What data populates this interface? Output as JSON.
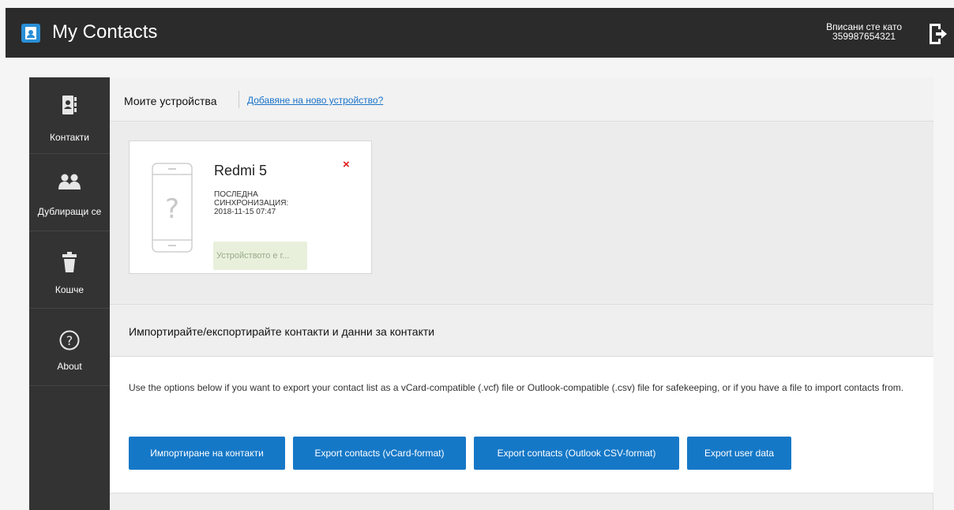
{
  "header": {
    "app_title": "My Contacts",
    "login_label": "Вписани сте като",
    "login_user": "359987654321",
    "logo_icon": "contacts-app-icon",
    "logout_icon": "logout-icon"
  },
  "sidebar": {
    "items": [
      {
        "label": "Контакти",
        "icon": "contacts-book-icon"
      },
      {
        "label": "Дублиращи се",
        "icon": "duplicate-people-icon"
      },
      {
        "label": "Кошче",
        "icon": "trash-icon"
      },
      {
        "label": "About",
        "icon": "question-circle-icon"
      }
    ]
  },
  "devices": {
    "title": "Моите устройства",
    "add_link": "Добавяне на ново устройство?",
    "list": [
      {
        "name": "Redmi 5",
        "sync_label": "ПОСЛЕДНА СИНХРОНИЗАЦИЯ:",
        "sync_time": "2018-11-15 07:47",
        "status": "Устройството е г...",
        "remove": "×"
      }
    ]
  },
  "import_export": {
    "title": "Импортирайте/експортирайте контакти и данни за контакти",
    "description": "Use the options below if you want to export your contact list as a vCard-compatible (.vcf) file or Outlook-compatible (.csv) file for safekeeping, or if you have a file to import contacts from.",
    "buttons": [
      "Импортиране на контакти",
      "Export contacts (vCard-format)",
      "Export contacts (Outlook CSV-format)",
      "Export user data"
    ]
  },
  "colors": {
    "header_bg": "#2b2b2b",
    "sidebar_bg": "#333333",
    "accent": "#1578c7",
    "link": "#1a73c9",
    "danger": "#e01b1b"
  }
}
